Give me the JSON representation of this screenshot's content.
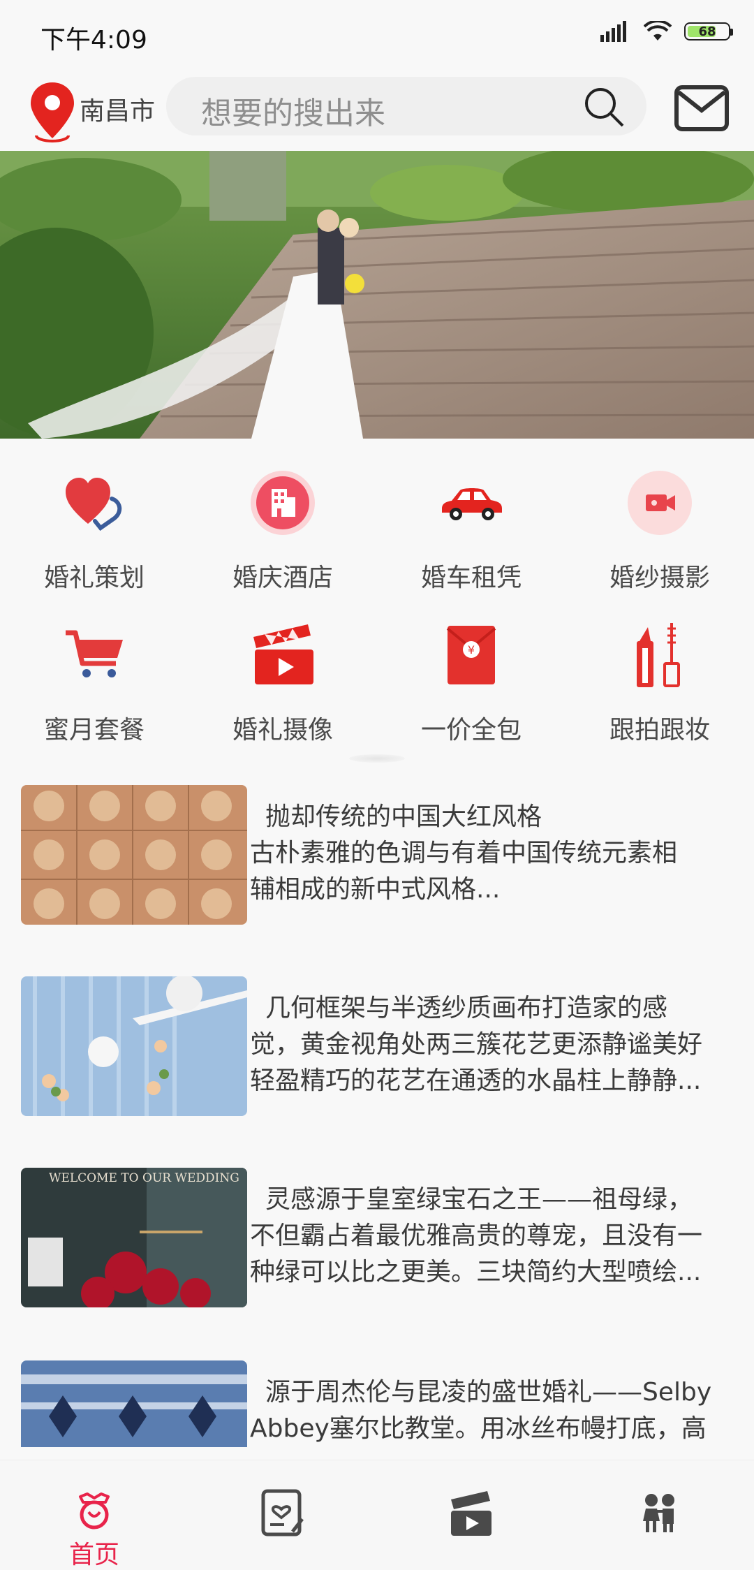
{
  "status": {
    "time": "下午4:09",
    "battery": "68"
  },
  "header": {
    "city": "南昌市",
    "search_placeholder": "想要的搜出来"
  },
  "categories": [
    {
      "label": "婚礼策划",
      "icon": "heart-icon"
    },
    {
      "label": "婚庆酒店",
      "icon": "building-icon"
    },
    {
      "label": "婚车租凭",
      "icon": "car-icon"
    },
    {
      "label": "婚纱摄影",
      "icon": "video-camera-icon"
    },
    {
      "label": "蜜月套餐",
      "icon": "cart-icon"
    },
    {
      "label": "婚礼摄像",
      "icon": "clapperboard-icon"
    },
    {
      "label": "一价全包",
      "icon": "red-envelope-icon"
    },
    {
      "label": "跟拍跟妆",
      "icon": "lipstick-icon"
    }
  ],
  "articles": [
    {
      "lines": [
        "抛却传统的中国大红风格",
        "古朴素雅的色调与有着中国传统元素相",
        "辅相成的新中式风格..."
      ]
    },
    {
      "lines": [
        "几何框架与半透纱质画布打造家的感",
        "觉，黄金视角处两三簇花艺更添静谧美好",
        "轻盈精巧的花艺在通透的水晶柱上静静..."
      ]
    },
    {
      "lines": [
        "灵感源于皇室绿宝石之王——祖母绿，",
        "不但霸占着最优雅高贵的尊宠，且没有一",
        "种绿可以比之更美。三块简约大型喷绘..."
      ]
    },
    {
      "lines": [
        "源于周杰伦与昆凌的盛世婚礼——Selby",
        "Abbey塞尔比教堂。用冰丝布幔打底，高"
      ]
    }
  ],
  "thumb_texts": {
    "wedding_sign": "WELCOME TO OUR WEDDING"
  },
  "bottom_nav": [
    {
      "label": "首页",
      "icon": "home-ring-icon",
      "active": true
    },
    {
      "label": "",
      "icon": "notes-icon"
    },
    {
      "label": "",
      "icon": "clapperboard-nav-icon"
    },
    {
      "label": "",
      "icon": "couple-icon"
    }
  ],
  "colors": {
    "accent": "#e8234a",
    "icon_red": "#e3312d"
  }
}
